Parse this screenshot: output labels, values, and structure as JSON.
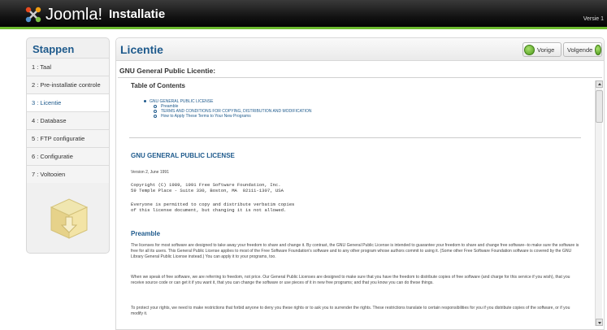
{
  "header": {
    "brand": "Joomla!",
    "title": "Installatie",
    "version": "Versie 1"
  },
  "sidebar": {
    "title": "Stappen",
    "steps": [
      {
        "label": "1 : Taal"
      },
      {
        "label": "2 : Pre-installatie controle"
      },
      {
        "label": "3 : Licentie"
      },
      {
        "label": "4 : Database"
      },
      {
        "label": "5 : FTP configuratie"
      },
      {
        "label": "6 : Configuratie"
      },
      {
        "label": "7 : Voltooien"
      }
    ],
    "active_step": 2
  },
  "main": {
    "title": "Licentie",
    "prev_label": "Vorige",
    "next_label": "Volgende",
    "section_title": "GNU General Public Licentie:"
  },
  "license": {
    "toc_title": "Table of Contents",
    "toc": [
      "GNU GENERAL PUBLIC LICENSE",
      "Preamble",
      "TERMS AND CONDITIONS FOR COPYING, DISTRIBUTION AND MODIFICATION",
      "How to Apply These Terms to Your New Programs"
    ],
    "heading": "GNU GENERAL PUBLIC LICENSE",
    "version_line": "Version 2, June 1991",
    "copyright": "Copyright (C) 1989, 1991 Free Software Foundation, Inc.\n59 Temple Place - Suite 330, Boston, MA  02111-1307, USA",
    "everyone": "Everyone is permitted to copy and distribute verbatim copies\nof this license document, but changing it is not allowed.",
    "preamble_heading": "Preamble",
    "para1": "The licenses for most software are designed to take away your freedom to share and change it. By contrast, the GNU General Public License is intended to guarantee your freedom to share and change free software--to make sure the software is free for all its users. This General Public License applies to most of the Free Software Foundation's software and to any other program whose authors commit to using it. (Some other Free Software Foundation software is covered by the GNU Library General Public License instead.) You can apply it to your programs, too.",
    "para2": "When we speak of free software, we are referring to freedom, not price. Our General Public Licenses are designed to make sure that you have the freedom to distribute copies of free software (and charge for this service if you wish), that you receive source code or can get it if you want it, that you can change the software or use pieces of it in new free programs; and that you know you can do these things.",
    "para3": "To protect your rights, we need to make restrictions that forbid anyone to deny you these rights or to ask you to surrender the rights. These restrictions translate to certain responsibilities for you if you distribute copies of the software, or if you modify it."
  },
  "colors": {
    "accent": "#1e5a8c",
    "brand_green": "#6dbb2f"
  },
  "icons": {
    "logo": "joomla-logo",
    "prev": "green-circle-left",
    "next": "green-circle-right",
    "box": "install-box-icon"
  }
}
